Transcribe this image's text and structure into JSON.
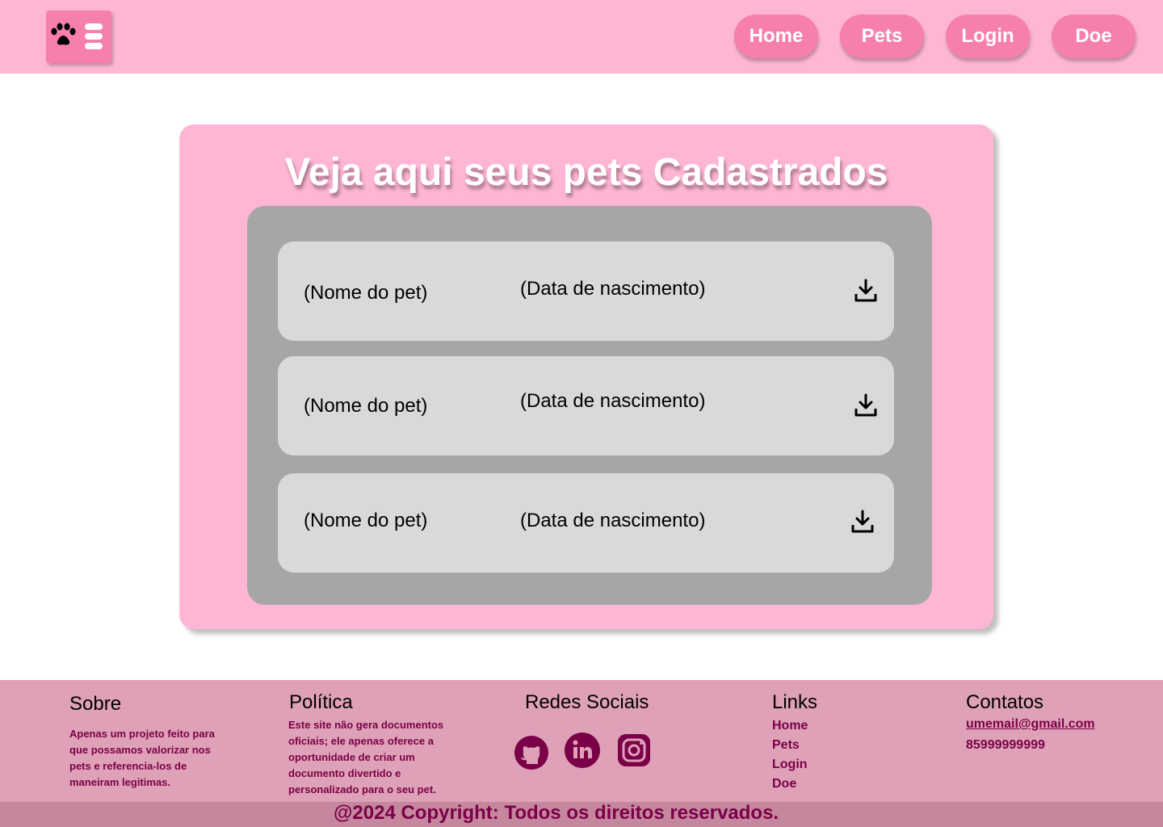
{
  "header": {
    "logo_icon": "paw-menu-icon",
    "nav": [
      {
        "label": "Home"
      },
      {
        "label": "Pets"
      },
      {
        "label": "Login"
      },
      {
        "label": "Doe"
      }
    ]
  },
  "main": {
    "title": "Veja aqui seus pets  Cadastrados",
    "pets": [
      {
        "name": "(Nome do pet)",
        "birth": "(Data de nascimento)",
        "icon": "download-icon"
      },
      {
        "name": "(Nome do pet)",
        "birth": "(Data de nascimento)",
        "icon": "download-icon"
      },
      {
        "name": "(Nome do pet)",
        "birth": "(Data de nascimento)",
        "icon": "download-icon"
      }
    ]
  },
  "footer": {
    "sobre": {
      "title": "Sobre",
      "lines": [
        "Apenas um projeto feito para",
        "que possamos valorizar nos",
        "pets e referencia-los de",
        "maneiram legitimas."
      ]
    },
    "politica": {
      "title": "Política",
      "lines": [
        "Este site não gera documentos",
        "oficiais; ele apenas oferece a",
        "oportunidade de criar um",
        "documento divertido e",
        "personalizado para o seu pet."
      ]
    },
    "redes": {
      "title": "Redes Sociais",
      "icons": [
        "github-icon",
        "linkedin-icon",
        "instagram-icon"
      ]
    },
    "links": {
      "title": "Links",
      "items": [
        "Home",
        "Pets",
        "Login",
        "Doe"
      ]
    },
    "contatos": {
      "title": "Contatos",
      "email": "umemail@gmail.com",
      "phone": "85999999999"
    },
    "copyright": "@2024 Copyright: Todos os direitos reservados."
  },
  "colors": {
    "header_bg": "#ffb6d5",
    "accent": "#f67fac",
    "panel": "#a6a6a6",
    "row": "#d9d9d9",
    "footer_bg": "#dfa1b7",
    "footer_text": "#7a0048"
  }
}
